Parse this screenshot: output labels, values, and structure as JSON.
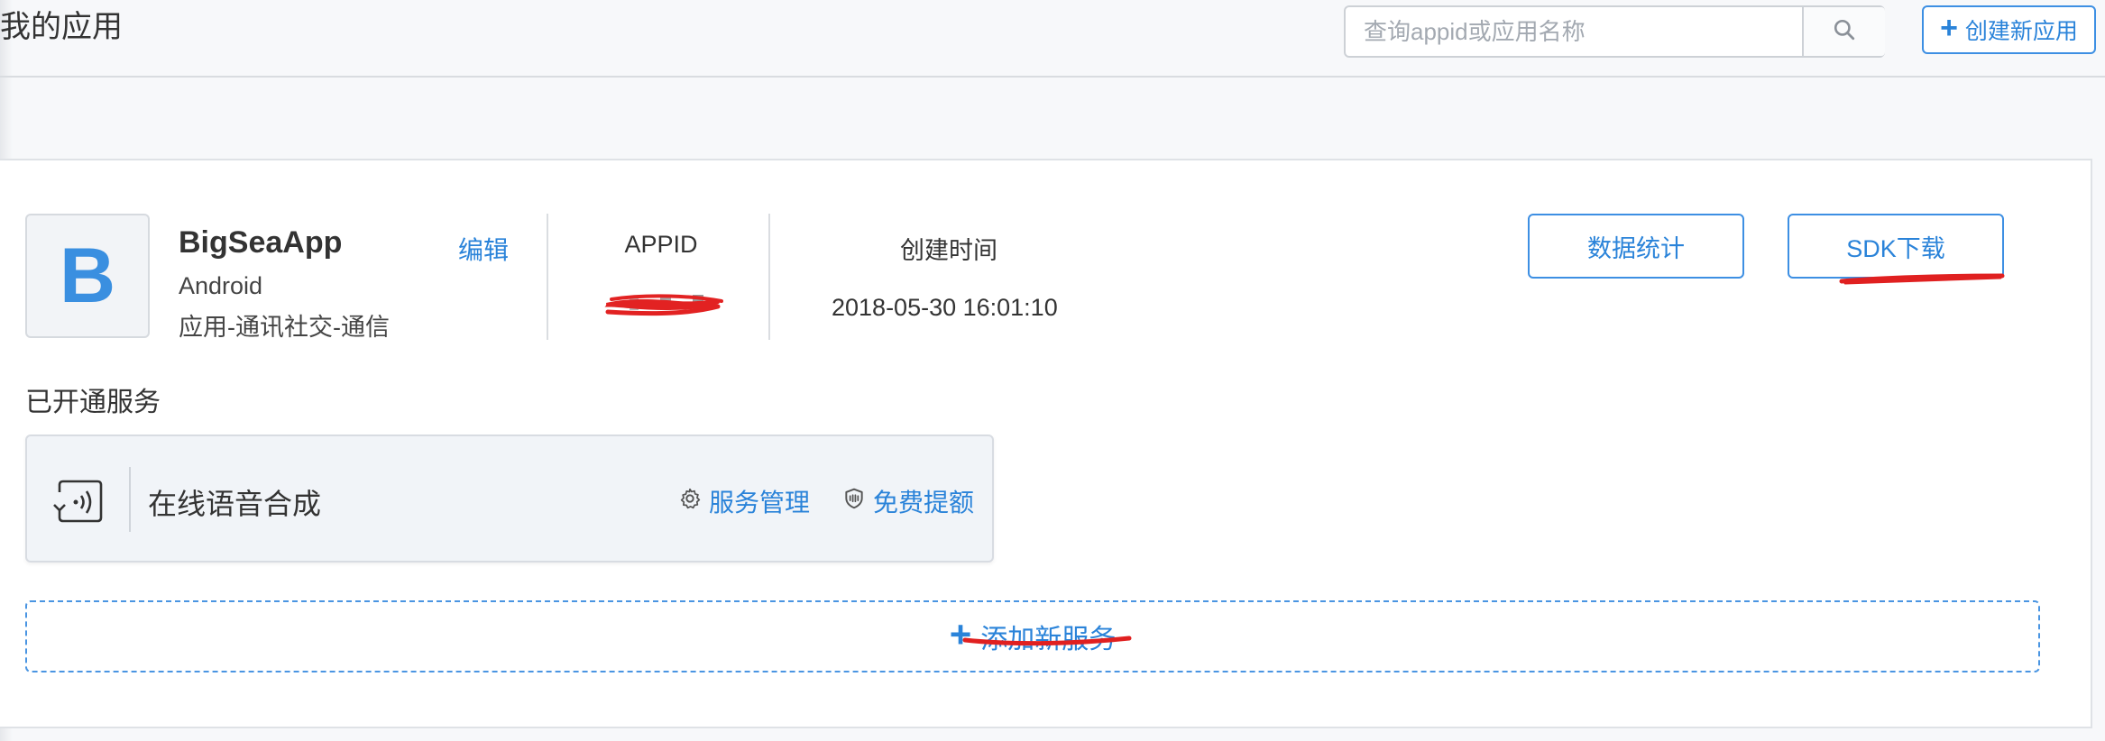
{
  "header": {
    "title": "我的应用",
    "search_placeholder": "查询appid或应用名称",
    "create_button": "创建新应用"
  },
  "app": {
    "icon_letter": "B",
    "name": "BigSeaApp",
    "platform": "Android",
    "category": "应用-通讯社交-通信",
    "edit_label": "编辑",
    "appid_label": "APPID",
    "created_label": "创建时间",
    "created_value": "2018-05-30 16:01:10",
    "stats_button": "数据统计",
    "sdk_button": "SDK下载"
  },
  "services": {
    "title": "已开通服务",
    "items": [
      {
        "icon": "speech-synthesis-icon",
        "name": "在线语音合成",
        "manage_label": "服务管理",
        "quota_label": "免费提额"
      }
    ],
    "add_label": "添加新服务"
  },
  "colors": {
    "accent": "#2a83d9",
    "annotation_red": "#e02020",
    "background": "#f7f8fa"
  }
}
